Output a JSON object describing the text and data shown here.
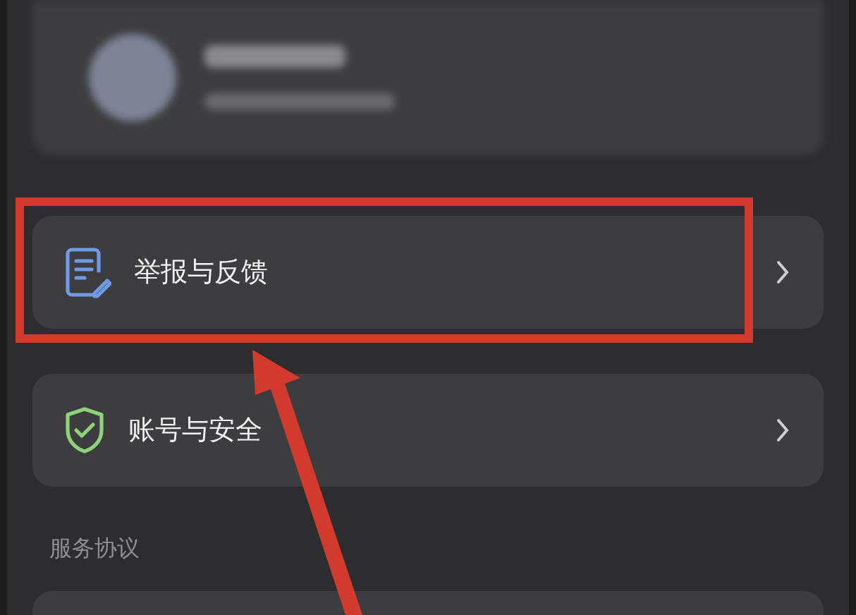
{
  "menu_items": [
    {
      "label": "举报与反馈",
      "kind": "report",
      "highlighted": true
    },
    {
      "label": "账号与安全",
      "kind": "security",
      "highlighted": false
    }
  ],
  "section_title": "服务协议"
}
